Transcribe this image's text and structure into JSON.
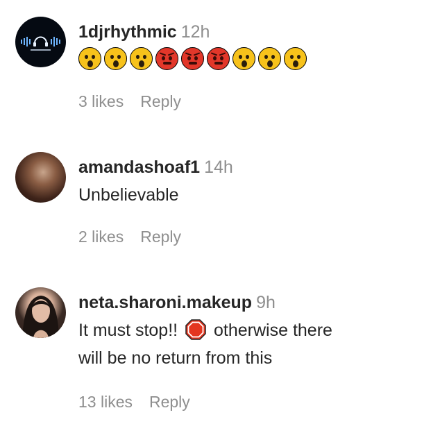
{
  "comments": [
    {
      "username": "1djrhythmic",
      "time": "12h",
      "emojis": [
        "astonished-face-icon",
        "astonished-face-icon",
        "astonished-face-icon",
        "angry-face-icon",
        "angry-face-icon",
        "angry-face-icon",
        "astonished-face-icon",
        "astonished-face-icon",
        "astonished-face-icon"
      ],
      "likes": "3 likes",
      "reply": "Reply"
    },
    {
      "username": "amandashoaf1",
      "time": "14h",
      "text": "Unbelievable",
      "likes": "2 likes",
      "reply": "Reply"
    },
    {
      "username": "neta.sharoni.makeup",
      "time": "9h",
      "text_part1": "It must stop!!",
      "text_icon": "stop-sign-icon",
      "text_part2": "otherwise there",
      "text_line2": "will be no return from this",
      "likes": "13 likes",
      "reply": "Reply"
    }
  ],
  "colors": {
    "text": "#262626",
    "muted": "#8e8e8e",
    "background": "#ffffff"
  }
}
